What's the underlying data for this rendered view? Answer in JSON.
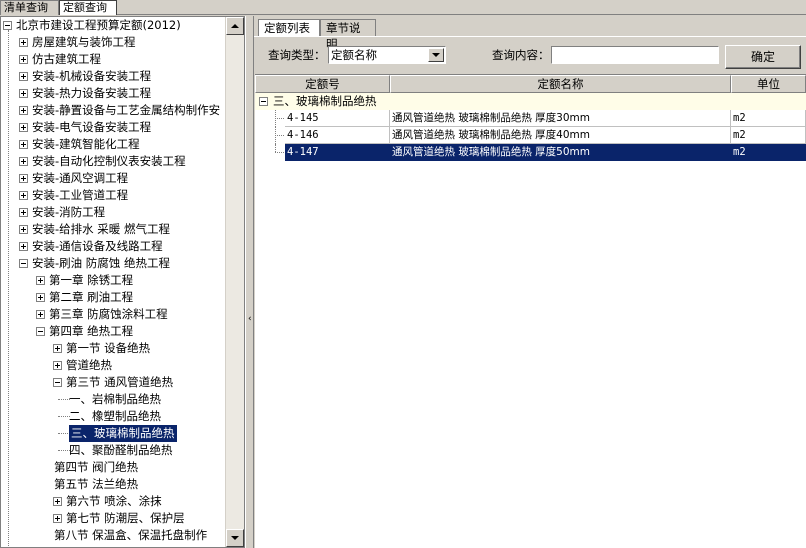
{
  "top_tabs": [
    "清单查询",
    "定额查询"
  ],
  "tree": {
    "root": "北京市建设工程预算定额(2012)",
    "items": [
      {
        "label": "房屋建筑与装饰工程",
        "level": 1,
        "state": "plus"
      },
      {
        "label": "仿古建筑工程",
        "level": 1,
        "state": "plus"
      },
      {
        "label": "安装-机械设备安装工程",
        "level": 1,
        "state": "plus"
      },
      {
        "label": "安装-热力设备安装工程",
        "level": 1,
        "state": "plus"
      },
      {
        "label": "安装-静置设备与工艺金属结构制作安",
        "level": 1,
        "state": "plus"
      },
      {
        "label": "安装-电气设备安装工程",
        "level": 1,
        "state": "plus"
      },
      {
        "label": "安装-建筑智能化工程",
        "level": 1,
        "state": "plus"
      },
      {
        "label": "安装-自动化控制仪表安装工程",
        "level": 1,
        "state": "plus"
      },
      {
        "label": "安装-通风空调工程",
        "level": 1,
        "state": "plus"
      },
      {
        "label": "安装-工业管道工程",
        "level": 1,
        "state": "plus"
      },
      {
        "label": "安装-消防工程",
        "level": 1,
        "state": "plus"
      },
      {
        "label": "安装-给排水 采暖 燃气工程",
        "level": 1,
        "state": "plus"
      },
      {
        "label": "安装-通信设备及线路工程",
        "level": 1,
        "state": "plus"
      },
      {
        "label": "安装-刷油 防腐蚀 绝热工程",
        "level": 1,
        "state": "minus"
      },
      {
        "label": "第一章 除锈工程",
        "level": 2,
        "state": "plus"
      },
      {
        "label": "第二章 刷油工程",
        "level": 2,
        "state": "plus"
      },
      {
        "label": "第三章 防腐蚀涂料工程",
        "level": 2,
        "state": "plus"
      },
      {
        "label": "第四章 绝热工程",
        "level": 2,
        "state": "minus"
      },
      {
        "label": "第一节 设备绝热",
        "level": 3,
        "state": "plus"
      },
      {
        "label": "管道绝热",
        "level": 3,
        "state": "plus"
      },
      {
        "label": "第三节 通风管道绝热",
        "level": 3,
        "state": "minus"
      },
      {
        "label": "一、岩棉制品绝热",
        "level": 4,
        "state": "leaf"
      },
      {
        "label": "二、橡塑制品绝热",
        "level": 4,
        "state": "leaf"
      },
      {
        "label": "三、玻璃棉制品绝热",
        "level": 4,
        "state": "leaf",
        "selected": true
      },
      {
        "label": "四、聚酚醛制品绝热",
        "level": 4,
        "state": "leaf"
      },
      {
        "label": "第四节 阀门绝热",
        "level": 3,
        "state": "none"
      },
      {
        "label": "第五节 法兰绝热",
        "level": 3,
        "state": "none"
      },
      {
        "label": "第六节 喷涂、涂抹",
        "level": 3,
        "state": "plus"
      },
      {
        "label": "第七节 防潮层、保护层",
        "level": 3,
        "state": "plus"
      },
      {
        "label": "第八节 保温盒、保温托盘制作",
        "level": 3,
        "state": "none"
      }
    ]
  },
  "right_tabs": [
    "定额列表",
    "章节说明"
  ],
  "query": {
    "type_label": "查询类型：",
    "type_value": "定额名称",
    "content_label": "查询内容：",
    "content_value": "",
    "ok_button": "确定"
  },
  "grid": {
    "columns": [
      "定额号",
      "定额名称",
      "单位"
    ],
    "group": "三、玻璃棉制品绝热",
    "rows": [
      {
        "code": "4-145",
        "name": "通风管道绝热 玻璃棉制品绝热 厚度30mm",
        "unit": "m2"
      },
      {
        "code": "4-146",
        "name": "通风管道绝热 玻璃棉制品绝热 厚度40mm",
        "unit": "m2"
      },
      {
        "code": "4-147",
        "name": "通风管道绝热 玻璃棉制品绝热 厚度50mm",
        "unit": "m2",
        "selected": true
      }
    ]
  },
  "colors": {
    "selection": "#0a246a",
    "face": "#d4d0c8"
  }
}
